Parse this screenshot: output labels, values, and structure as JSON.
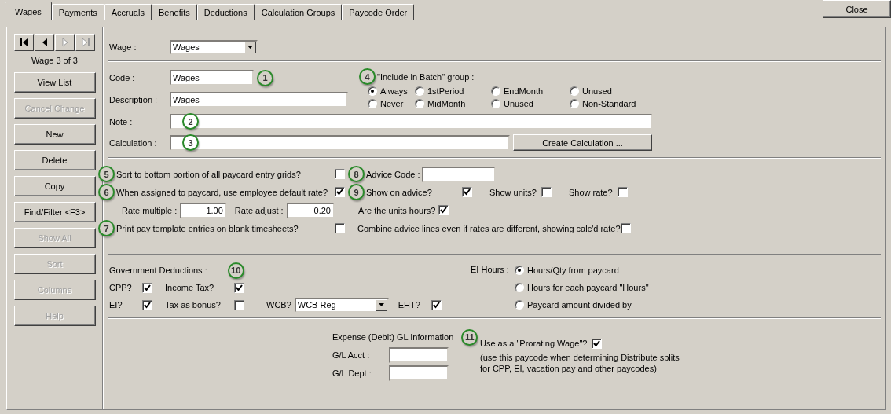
{
  "tabs": [
    {
      "label": "Wages",
      "selected": true
    },
    {
      "label": "Payments",
      "selected": false
    },
    {
      "label": "Accruals",
      "selected": false
    },
    {
      "label": "Benefits",
      "selected": false
    },
    {
      "label": "Deductions",
      "selected": false
    },
    {
      "label": "Calculation Groups",
      "selected": false
    },
    {
      "label": "Paycode Order",
      "selected": false
    }
  ],
  "close_button": "Close",
  "navigator": [
    {
      "kind": "first",
      "disabled": false
    },
    {
      "kind": "prev",
      "disabled": false
    },
    {
      "kind": "next",
      "disabled": true
    },
    {
      "kind": "last",
      "disabled": true
    }
  ],
  "record_label": "Wage 3 of 3",
  "side_buttons": [
    {
      "label": "View List",
      "disabled": false
    },
    {
      "label": "Cancel Change",
      "disabled": true
    },
    {
      "label": "New",
      "disabled": false
    },
    {
      "label": "Delete",
      "disabled": false
    },
    {
      "label": "Copy",
      "disabled": false
    },
    {
      "label": "Find/Filter <F3>",
      "disabled": false
    },
    {
      "label": "Show All",
      "disabled": true
    },
    {
      "label": "Sort",
      "disabled": true
    },
    {
      "label": "Columns",
      "disabled": true
    },
    {
      "label": "Help",
      "disabled": true
    }
  ],
  "wage_select": {
    "label": "Wage :",
    "value": "Wages"
  },
  "code": {
    "label": "Code :",
    "value": "Wages",
    "callout": "1"
  },
  "description": {
    "label": "Description :",
    "value": "Wages"
  },
  "note": {
    "label": "Note :",
    "callout": "2"
  },
  "calculation": {
    "label": "Calculation :",
    "callout": "3"
  },
  "create_calculation_button": "Create Calculation ...",
  "batch_group": {
    "callout": "4",
    "label": "\"Include in Batch\" group :",
    "options": [
      {
        "label": "Always",
        "selected": true
      },
      {
        "label": "1stPeriod",
        "selected": false
      },
      {
        "label": "EndMonth",
        "selected": false
      },
      {
        "label": "Unused",
        "selected": false
      },
      {
        "label": "Never",
        "selected": false
      },
      {
        "label": "MidMonth",
        "selected": false
      },
      {
        "label": "Unused",
        "selected": false
      },
      {
        "label": "Non-Standard",
        "selected": false
      }
    ]
  },
  "sort_bottom": {
    "callout": "5",
    "label": "Sort to bottom portion of all paycard entry grids?",
    "checked": false
  },
  "default_rate": {
    "callout": "6",
    "label": "When assigned to paycard, use employee default rate?",
    "checked": true
  },
  "rate_multiple": {
    "label": "Rate multiple :",
    "value": "1.00"
  },
  "rate_adjust": {
    "label": "Rate adjust :",
    "value": "0.20"
  },
  "print_template": {
    "callout": "7",
    "label": "Print pay template entries on blank timesheets?",
    "checked": false
  },
  "advice_code": {
    "callout": "8",
    "label": "Advice Code :"
  },
  "show_on_advice": {
    "callout": "9",
    "label": "Show on advice?",
    "checked": true
  },
  "show_units": {
    "label": "Show units?",
    "checked": false
  },
  "show_rate": {
    "label": "Show rate?",
    "checked": false
  },
  "units_hours": {
    "label": "Are the units hours?",
    "checked": true
  },
  "combine_advice": {
    "label": "Combine advice lines even if rates are different, showing calc'd rate?",
    "checked": false
  },
  "government": {
    "label": "Government Deductions :",
    "callout": "10",
    "cpp": {
      "label": "CPP?",
      "checked": true
    },
    "income_tax": {
      "label": "Income Tax?",
      "checked": true
    },
    "ei": {
      "label": "EI?",
      "checked": true
    },
    "tax_bonus": {
      "label": "Tax as bonus?",
      "checked": false
    },
    "wcb": {
      "label": "WCB?",
      "value": "WCB Reg"
    },
    "eht": {
      "label": "EHT?",
      "checked": true
    }
  },
  "ei_hours": {
    "label": "EI Hours :",
    "options": [
      {
        "label": "Hours/Qty from paycard",
        "selected": true
      },
      {
        "label": "Hours for each paycard \"Hours\"",
        "selected": false
      },
      {
        "label": "Paycard amount divided by",
        "selected": false
      }
    ]
  },
  "gl": {
    "title": "Expense (Debit) GL Information",
    "callout": "11",
    "acct_label": "G/L Acct :",
    "dept_label": "G/L Dept :"
  },
  "prorating": {
    "label": "Use as a \"Prorating Wage\"?",
    "checked": true,
    "note_lines": [
      "(use this paycode when determining Distribute splits",
      "for CPP, EI, vacation pay and other paycodes)"
    ]
  }
}
